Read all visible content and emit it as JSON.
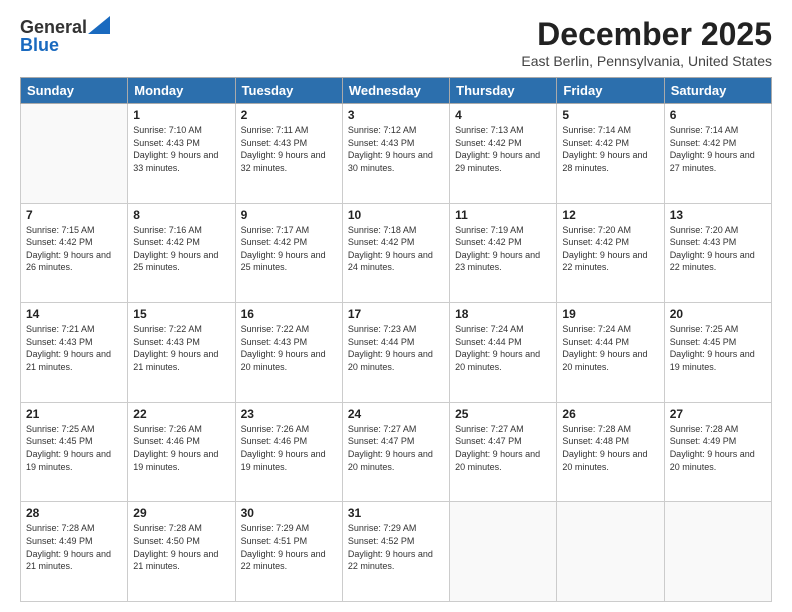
{
  "header": {
    "logo_general": "General",
    "logo_blue": "Blue",
    "month_title": "December 2025",
    "location": "East Berlin, Pennsylvania, United States"
  },
  "days_of_week": [
    "Sunday",
    "Monday",
    "Tuesday",
    "Wednesday",
    "Thursday",
    "Friday",
    "Saturday"
  ],
  "weeks": [
    [
      {
        "day": "",
        "sunrise": "",
        "sunset": "",
        "daylight": "",
        "empty": true
      },
      {
        "day": "1",
        "sunrise": "7:10 AM",
        "sunset": "4:43 PM",
        "daylight": "9 hours and 33 minutes."
      },
      {
        "day": "2",
        "sunrise": "7:11 AM",
        "sunset": "4:43 PM",
        "daylight": "9 hours and 32 minutes."
      },
      {
        "day": "3",
        "sunrise": "7:12 AM",
        "sunset": "4:43 PM",
        "daylight": "9 hours and 30 minutes."
      },
      {
        "day": "4",
        "sunrise": "7:13 AM",
        "sunset": "4:42 PM",
        "daylight": "9 hours and 29 minutes."
      },
      {
        "day": "5",
        "sunrise": "7:14 AM",
        "sunset": "4:42 PM",
        "daylight": "9 hours and 28 minutes."
      },
      {
        "day": "6",
        "sunrise": "7:14 AM",
        "sunset": "4:42 PM",
        "daylight": "9 hours and 27 minutes."
      }
    ],
    [
      {
        "day": "7",
        "sunrise": "7:15 AM",
        "sunset": "4:42 PM",
        "daylight": "9 hours and 26 minutes."
      },
      {
        "day": "8",
        "sunrise": "7:16 AM",
        "sunset": "4:42 PM",
        "daylight": "9 hours and 25 minutes."
      },
      {
        "day": "9",
        "sunrise": "7:17 AM",
        "sunset": "4:42 PM",
        "daylight": "9 hours and 25 minutes."
      },
      {
        "day": "10",
        "sunrise": "7:18 AM",
        "sunset": "4:42 PM",
        "daylight": "9 hours and 24 minutes."
      },
      {
        "day": "11",
        "sunrise": "7:19 AM",
        "sunset": "4:42 PM",
        "daylight": "9 hours and 23 minutes."
      },
      {
        "day": "12",
        "sunrise": "7:20 AM",
        "sunset": "4:42 PM",
        "daylight": "9 hours and 22 minutes."
      },
      {
        "day": "13",
        "sunrise": "7:20 AM",
        "sunset": "4:43 PM",
        "daylight": "9 hours and 22 minutes."
      }
    ],
    [
      {
        "day": "14",
        "sunrise": "7:21 AM",
        "sunset": "4:43 PM",
        "daylight": "9 hours and 21 minutes."
      },
      {
        "day": "15",
        "sunrise": "7:22 AM",
        "sunset": "4:43 PM",
        "daylight": "9 hours and 21 minutes."
      },
      {
        "day": "16",
        "sunrise": "7:22 AM",
        "sunset": "4:43 PM",
        "daylight": "9 hours and 20 minutes."
      },
      {
        "day": "17",
        "sunrise": "7:23 AM",
        "sunset": "4:44 PM",
        "daylight": "9 hours and 20 minutes."
      },
      {
        "day": "18",
        "sunrise": "7:24 AM",
        "sunset": "4:44 PM",
        "daylight": "9 hours and 20 minutes."
      },
      {
        "day": "19",
        "sunrise": "7:24 AM",
        "sunset": "4:44 PM",
        "daylight": "9 hours and 20 minutes."
      },
      {
        "day": "20",
        "sunrise": "7:25 AM",
        "sunset": "4:45 PM",
        "daylight": "9 hours and 19 minutes."
      }
    ],
    [
      {
        "day": "21",
        "sunrise": "7:25 AM",
        "sunset": "4:45 PM",
        "daylight": "9 hours and 19 minutes."
      },
      {
        "day": "22",
        "sunrise": "7:26 AM",
        "sunset": "4:46 PM",
        "daylight": "9 hours and 19 minutes."
      },
      {
        "day": "23",
        "sunrise": "7:26 AM",
        "sunset": "4:46 PM",
        "daylight": "9 hours and 19 minutes."
      },
      {
        "day": "24",
        "sunrise": "7:27 AM",
        "sunset": "4:47 PM",
        "daylight": "9 hours and 20 minutes."
      },
      {
        "day": "25",
        "sunrise": "7:27 AM",
        "sunset": "4:47 PM",
        "daylight": "9 hours and 20 minutes."
      },
      {
        "day": "26",
        "sunrise": "7:28 AM",
        "sunset": "4:48 PM",
        "daylight": "9 hours and 20 minutes."
      },
      {
        "day": "27",
        "sunrise": "7:28 AM",
        "sunset": "4:49 PM",
        "daylight": "9 hours and 20 minutes."
      }
    ],
    [
      {
        "day": "28",
        "sunrise": "7:28 AM",
        "sunset": "4:49 PM",
        "daylight": "9 hours and 21 minutes."
      },
      {
        "day": "29",
        "sunrise": "7:28 AM",
        "sunset": "4:50 PM",
        "daylight": "9 hours and 21 minutes."
      },
      {
        "day": "30",
        "sunrise": "7:29 AM",
        "sunset": "4:51 PM",
        "daylight": "9 hours and 22 minutes."
      },
      {
        "day": "31",
        "sunrise": "7:29 AM",
        "sunset": "4:52 PM",
        "daylight": "9 hours and 22 minutes."
      },
      {
        "day": "",
        "sunrise": "",
        "sunset": "",
        "daylight": "",
        "empty": true
      },
      {
        "day": "",
        "sunrise": "",
        "sunset": "",
        "daylight": "",
        "empty": true
      },
      {
        "day": "",
        "sunrise": "",
        "sunset": "",
        "daylight": "",
        "empty": true
      }
    ]
  ],
  "labels": {
    "sunrise": "Sunrise:",
    "sunset": "Sunset:",
    "daylight": "Daylight:"
  }
}
